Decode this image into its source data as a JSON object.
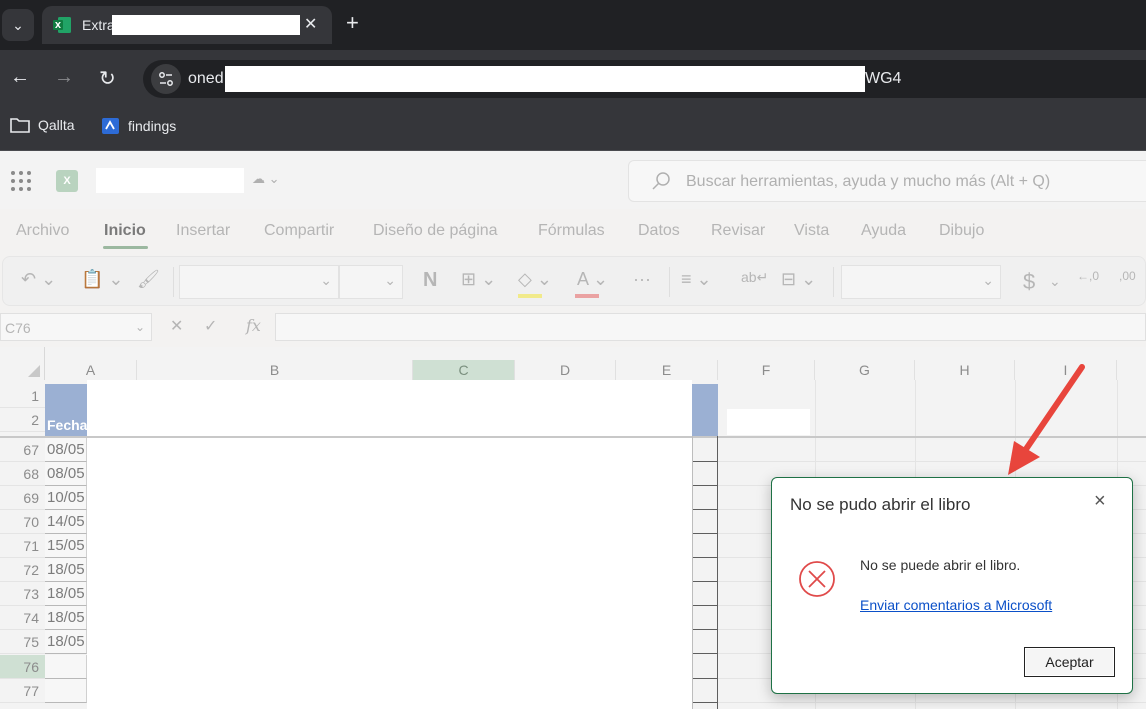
{
  "browser": {
    "tab_title": "Extra",
    "url_start": "oned",
    "url_end": "WG4",
    "new_tab": "+",
    "bookmarks": [
      {
        "label": "Qallta"
      },
      {
        "label": "findings"
      }
    ]
  },
  "excel": {
    "search_placeholder": "Buscar herramientas, ayuda y mucho más (Alt + Q)",
    "menu_tabs": [
      "Archivo",
      "Inicio",
      "Insertar",
      "Compartir",
      "Diseño de página",
      "Fórmulas",
      "Datos",
      "Revisar",
      "Vista",
      "Ayuda",
      "Dibujo"
    ],
    "active_tab": "Inicio",
    "ribbon": {
      "bold": "N",
      "currency": "$",
      "more": "···"
    },
    "name_box": "C76",
    "fx_label": "fx",
    "columns": [
      "A",
      "B",
      "C",
      "D",
      "E",
      "F",
      "G",
      "H",
      "I"
    ],
    "selected_column": "C",
    "header_label": "Fecha",
    "rows": [
      {
        "num": "1",
        "value": ""
      },
      {
        "num": "2",
        "value": ""
      },
      {
        "num": "67",
        "value": "08/05"
      },
      {
        "num": "68",
        "value": "08/05"
      },
      {
        "num": "69",
        "value": "10/05"
      },
      {
        "num": "70",
        "value": "14/05"
      },
      {
        "num": "71",
        "value": "15/05"
      },
      {
        "num": "72",
        "value": "18/05"
      },
      {
        "num": "73",
        "value": "18/05"
      },
      {
        "num": "74",
        "value": "18/05"
      },
      {
        "num": "75",
        "value": "18/05"
      },
      {
        "num": "76",
        "value": ""
      },
      {
        "num": "77",
        "value": ""
      }
    ]
  },
  "dialog": {
    "title": "No se pudo abrir el libro",
    "close": "×",
    "message": "No se puede abrir el libro.",
    "link": "Enviar comentarios a Microsoft",
    "ok_button": "Aceptar"
  },
  "colors": {
    "accent_green": "#1e7145",
    "header_blue": "#9bb0d3",
    "arrow_red": "#e8453c",
    "error_red": "#e04a4a"
  }
}
